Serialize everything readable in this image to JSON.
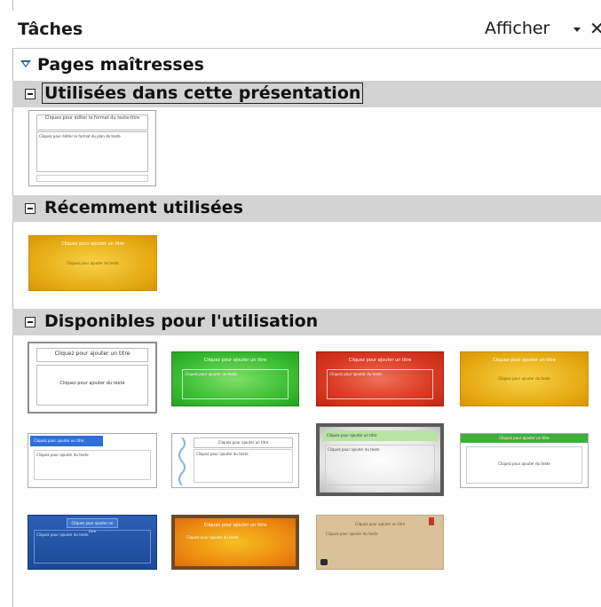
{
  "panel": {
    "title": "Tâches",
    "view_menu_label": "Afficher",
    "close_symbol": "✕"
  },
  "master_pages": {
    "label": "Pages maîtresses"
  },
  "sections": {
    "used": {
      "label": "Utilisées dans cette présentation"
    },
    "recent": {
      "label": "Récemment utilisées"
    },
    "available": {
      "label": "Disponibles pour l'utilisation"
    }
  },
  "thumb_text": {
    "default_title": "Cliquez pour éditer le format du texte-titre",
    "default_body": "Cliquez pour éditer le format du plan de texte",
    "add_title": "Cliquez pour ajouter un titre",
    "add_text": "Cliquez pour ajouter du texte"
  },
  "colors": {
    "section_bar": "#d3d3d3",
    "accent_blue": "#2f5e8e"
  }
}
